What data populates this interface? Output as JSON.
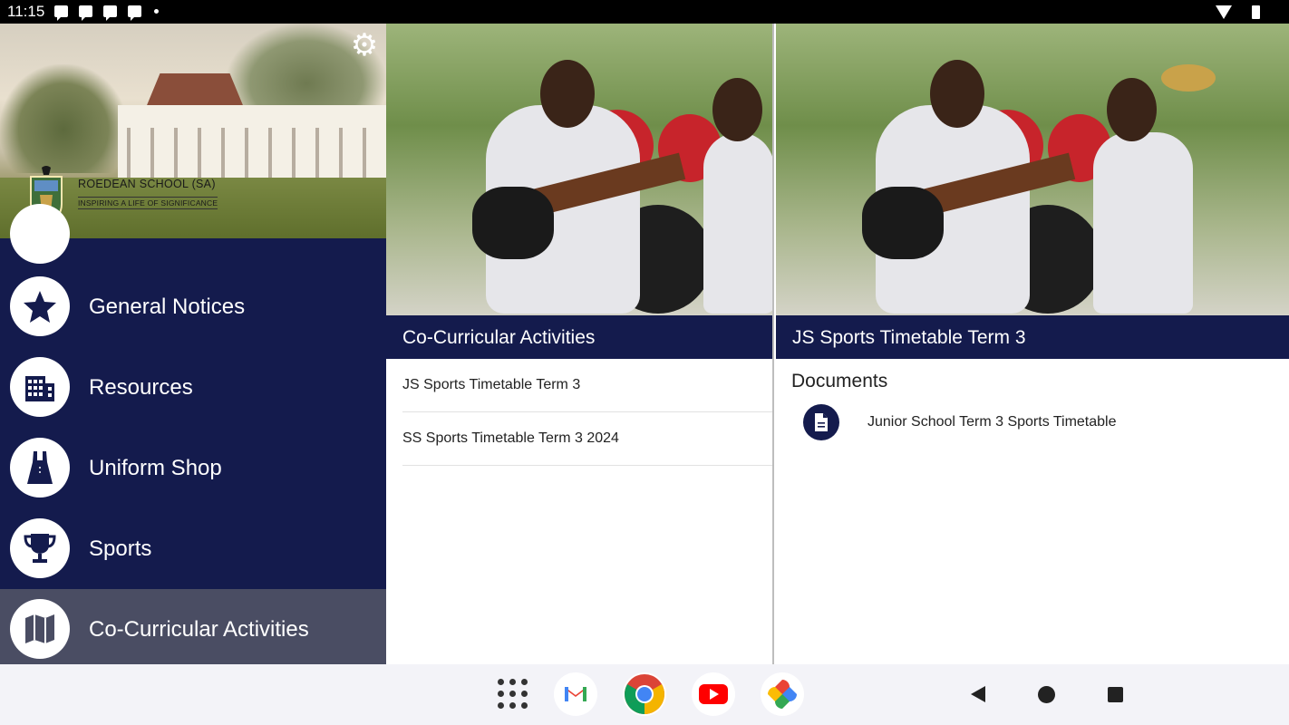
{
  "status_bar": {
    "time": "11:15"
  },
  "drawer": {
    "school_name": "ROEDEAN SCHOOL (SA)",
    "motto": "INSPIRING A LIFE OF SIGNIFICANCE",
    "items": [
      {
        "label": "General Notices",
        "icon": "star-icon"
      },
      {
        "label": "Resources",
        "icon": "building-icon"
      },
      {
        "label": "Uniform Shop",
        "icon": "dress-icon"
      },
      {
        "label": "Sports",
        "icon": "trophy-icon"
      },
      {
        "label": "Co-Curricular Activities",
        "icon": "map-icon",
        "active": true
      }
    ]
  },
  "middle_pane": {
    "title": "Co-Curricular Activities",
    "items": [
      {
        "label": "JS Sports Timetable Term 3"
      },
      {
        "label": "SS Sports Timetable Term 3 2024"
      }
    ]
  },
  "right_pane": {
    "title": "JS Sports Timetable Term 3",
    "section_heading": "Documents",
    "documents": [
      {
        "label": "Junior School Term 3 Sports Timetable",
        "icon": "document-icon"
      }
    ]
  },
  "nav_bar": {
    "apps": [
      "app-drawer-icon",
      "gmail-icon",
      "chrome-icon",
      "youtube-icon",
      "photos-icon"
    ],
    "buttons": [
      "back-icon",
      "home-icon",
      "recents-icon"
    ]
  },
  "colors": {
    "primary": "#141b4d",
    "active_item": "#4a4d63",
    "status_bar": "#000000"
  }
}
